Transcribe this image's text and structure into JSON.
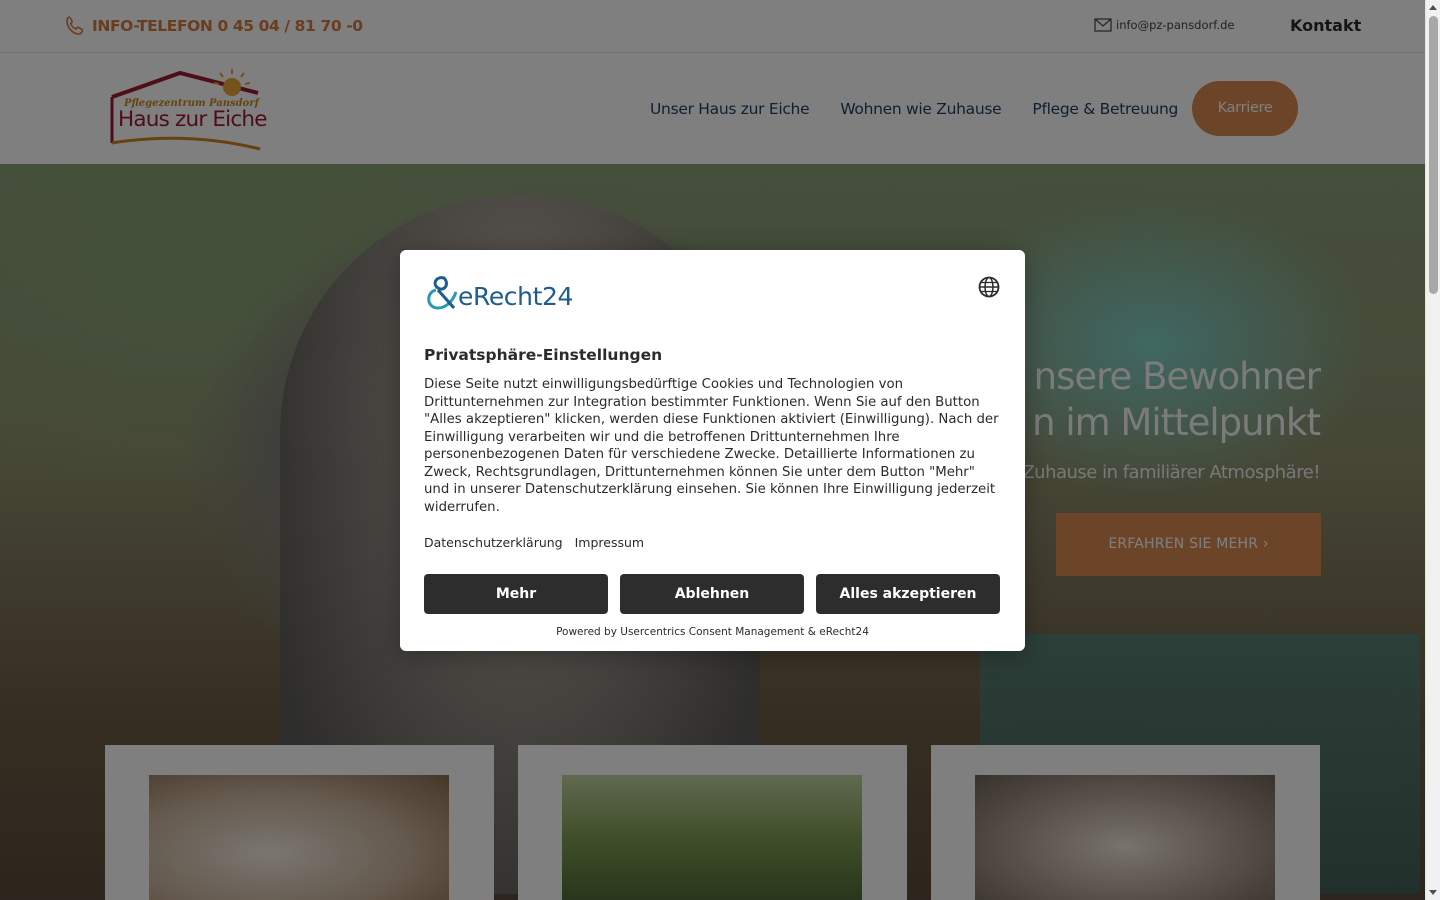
{
  "topbar": {
    "phone": "INFO-TELEFON 0 45 04 / 81 70 -0",
    "email": "info@pz-pansdorf.de",
    "contact": "Kontakt"
  },
  "logo": {
    "line1": "Pflegezentrum Pansdorf",
    "line2": "Haus zur Eiche"
  },
  "nav": {
    "items": [
      "Unser Haus zur Eiche",
      "Wohnen wie Zuhause",
      "Pflege & Betreuung"
    ],
    "cta": "Karriere"
  },
  "hero": {
    "title_line1": "nsere Bewohner",
    "title_line2": "n im Mittelpunkt",
    "subtitle": "Zuhause in familiärer Atmosphäre!",
    "button": "ERFAHREN SIE MEHR"
  },
  "consent": {
    "brand": "eRecht24",
    "title": "Privatsphäre-Einstellungen",
    "body": "Diese Seite nutzt einwilligungsbedürftige Cookies und Technologien von Drittunternehmen zur Integration bestimmter Funktionen. Wenn Sie auf den Button \"Alles akzeptieren\" klicken, werden diese Funktionen aktiviert (Einwilligung). Nach der Einwilligung verarbeiten wir und die betroffenen Drittunternehmen Ihre personenbezogenen Daten für verschiedene Zwecke. Detaillierte Informationen zu Zweck, Rechtsgrundlagen, Drittunternehmen können Sie unter dem Button \"Mehr\" und in unserer Datenschutzerklärung einsehen. Sie können Ihre Einwilligung jederzeit widerrufen.",
    "link_privacy": "Datenschutzerklärung",
    "link_imprint": "Impressum",
    "btn_more": "Mehr",
    "btn_decline": "Ablehnen",
    "btn_accept": "Alles akzeptieren",
    "powered": "Powered by Usercentrics Consent Management & eRecht24"
  },
  "colors": {
    "accent": "#d98a52",
    "nav_text": "#1f3f5f",
    "button_dark": "#2d2d2d",
    "brand_blue": "#1d5d8b"
  }
}
